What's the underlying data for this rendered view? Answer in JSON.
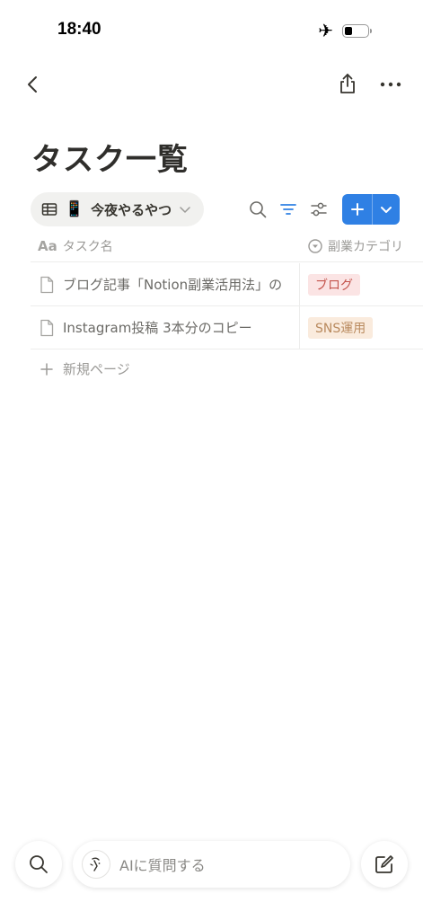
{
  "status_bar": {
    "time": "18:40",
    "battery_level": 0.35
  },
  "page": {
    "title": "タスク一覧"
  },
  "view": {
    "emoji": "📱",
    "name": "今夜やるやつ"
  },
  "table": {
    "columns": {
      "name": "タスク名",
      "category": "副業カテゴリ"
    },
    "rows": [
      {
        "name": "ブログ記事「Notion副業活用法」の",
        "category": "ブログ",
        "tag_bg": "#fbe4e4",
        "tag_fg": "#c4554d"
      },
      {
        "name": "Instagram投稿 3本分のコピー",
        "category": "SNS運用",
        "tag_bg": "#faebdd",
        "tag_fg": "#b98a5e"
      }
    ],
    "new_page_label": "新規ページ"
  },
  "ai": {
    "placeholder": "AIに質問する"
  },
  "colors": {
    "accent": "#2f80e4"
  }
}
